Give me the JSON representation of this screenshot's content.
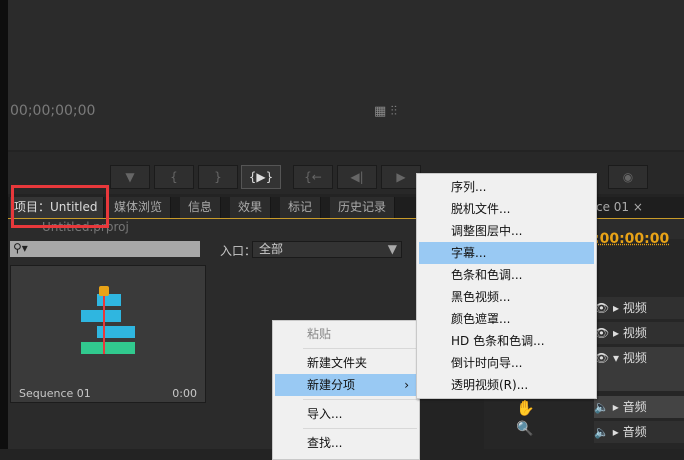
{
  "monitor": {
    "timecode": "00;00;00;00",
    "icons": [
      "film-icon",
      "waveform-icon"
    ]
  },
  "transport": {
    "icons": [
      "marker-icon",
      "mark-in-icon",
      "mark-out-icon",
      "go-in-out-icon",
      "go-to-in-icon",
      "step-back-icon",
      "play-icon",
      "camera-icon"
    ],
    "glyphs": [
      "▼",
      "{",
      "}",
      "{▶}",
      "{←",
      "◀|",
      "▶",
      "◉"
    ]
  },
  "tabs": [
    {
      "label": "项目：Untitled",
      "close": "×"
    },
    {
      "label": "媒体浏览"
    },
    {
      "label": "信息"
    },
    {
      "label": "效果"
    },
    {
      "label": "标记"
    },
    {
      "label": "历史记录"
    }
  ],
  "project": {
    "filename": "Untitled.prproj",
    "entry_label": "入口：",
    "entry_value": "全部",
    "thumb_name": "Sequence 01",
    "thumb_duration": "0:00"
  },
  "sequence": {
    "tab_label": "ce 01",
    "close": "×",
    "timecode": ":00:00:00",
    "tracks": [
      "视频",
      "视频",
      "视频",
      "音频",
      "音频"
    ]
  },
  "context_menu": {
    "items": [
      "粘贴",
      "新建文件夹",
      "新建分项",
      "导入...",
      "查找..."
    ],
    "highlighted": "新建分项",
    "arrow": "›"
  },
  "submenu": {
    "items": [
      "序列...",
      "脱机文件...",
      "调整图层中...",
      "字幕...",
      "色条和色调...",
      "黑色视频...",
      "颜色遮罩...",
      "HD 色条和色调...",
      "倒计时向导...",
      "透明视频(R)..."
    ],
    "highlighted": "字幕..."
  },
  "colors": {
    "accent": "#e8a317",
    "highlight": "#99c9f3",
    "annotation": "#e8383b"
  }
}
